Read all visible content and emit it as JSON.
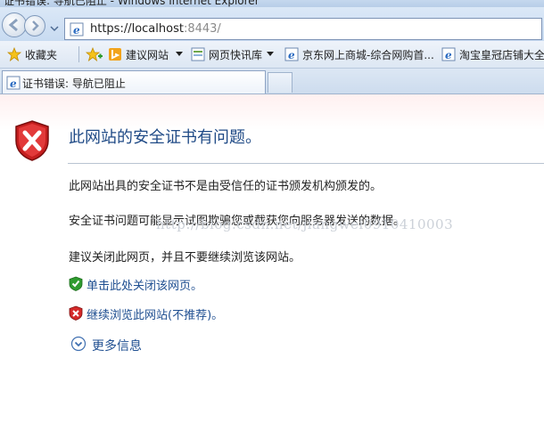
{
  "window": {
    "title": "证书错误: 导航已阻止 - Windows Internet Explorer"
  },
  "address_bar": {
    "url_host": "https://localhost",
    "url_port": ":8443/"
  },
  "favorites_bar": {
    "favorites_label": "收藏夹",
    "items": [
      {
        "label": "建议网站",
        "icon": "bing-icon"
      },
      {
        "label": "网页快讯库",
        "icon": "web-slice-icon"
      },
      {
        "label": "京东网上商城-综合网购首...",
        "icon": "ie-page-icon"
      },
      {
        "label": "淘宝皇冠店铺大全",
        "icon": "ie-page-icon"
      }
    ]
  },
  "tabs": [
    {
      "label": "证书错误: 导航已阻止"
    }
  ],
  "error_page": {
    "headline": "此网站的安全证书有问题。",
    "paragraphs": [
      "此网站出具的安全证书不是由受信任的证书颁发机构颁发的。",
      "安全证书问题可能显示试图欺骗您或截获您向服务器发送的数据。",
      "建议关闭此网页，并且不要继续浏览该网站。"
    ],
    "close_link": "单击此处关闭该网页。",
    "continue_link": "继续浏览此网站(不推荐)。",
    "more_info": "更多信息",
    "watermark": "http://blog.csdn.net/jiangwei0910410003"
  },
  "colors": {
    "link": "#1f4f91",
    "headline": "#1f4a86",
    "shield_red": "#d42a2a",
    "shield_green": "#3aa53a"
  }
}
